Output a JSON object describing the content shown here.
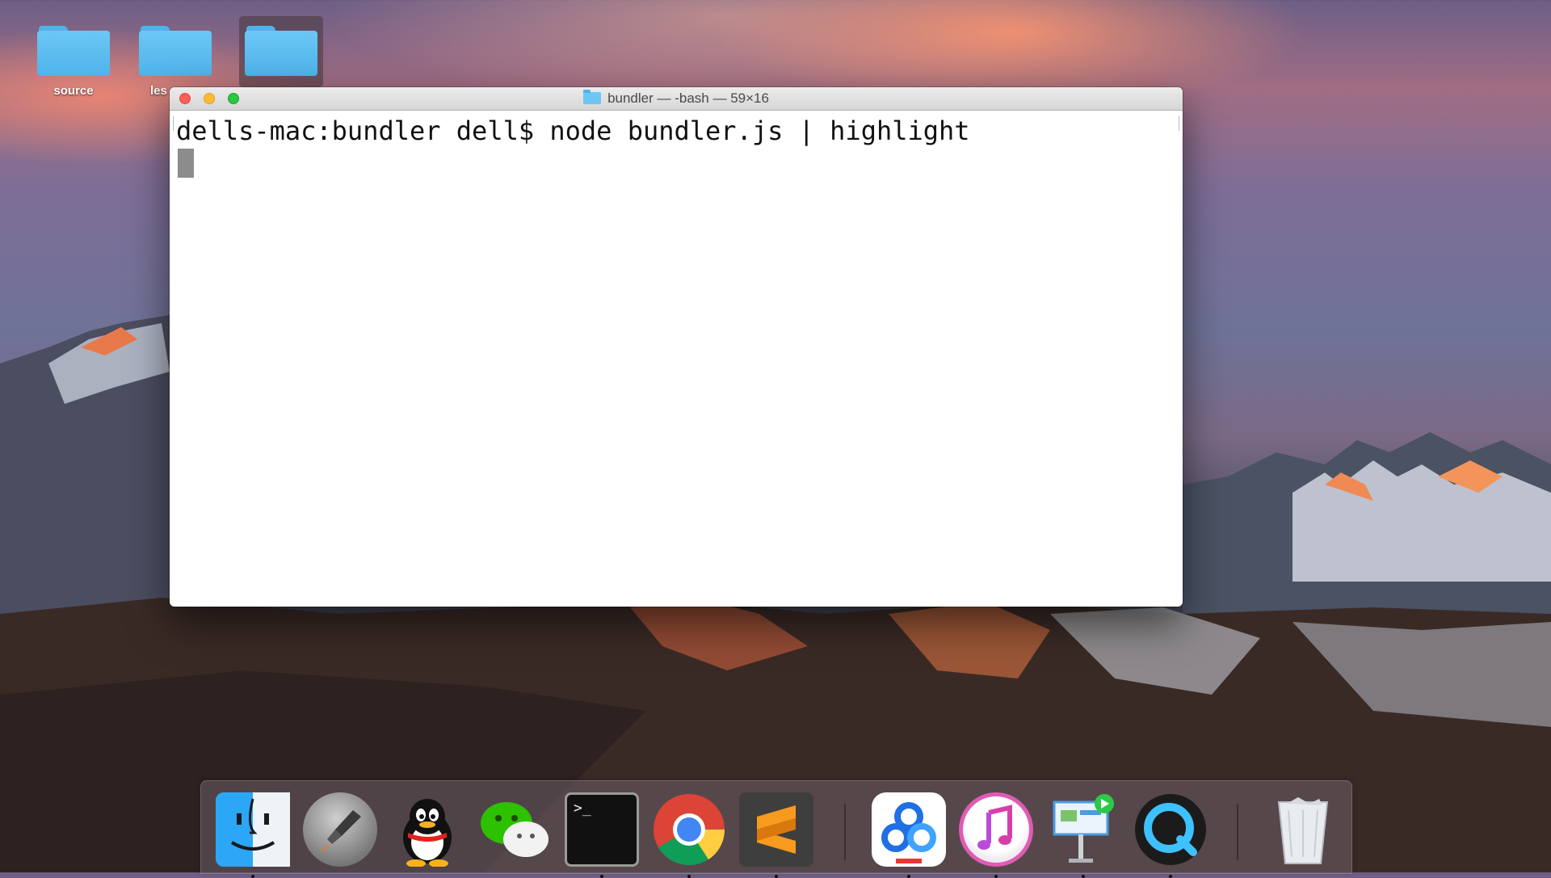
{
  "desktop": {
    "icons": [
      {
        "label": "source"
      },
      {
        "label": "les"
      },
      {
        "label": ""
      }
    ]
  },
  "terminal": {
    "title": "bundler — -bash — 59×16",
    "lines": [
      "dells-mac:bundler dell$ node bundler.js | highlight"
    ]
  },
  "dock": {
    "items": [
      {
        "icon": "finder-icon"
      },
      {
        "icon": "launchpad-icon"
      },
      {
        "icon": "qq-icon"
      },
      {
        "icon": "wechat-icon"
      },
      {
        "icon": "terminal-icon",
        "glyph": ">_"
      },
      {
        "icon": "chrome-icon"
      },
      {
        "icon": "sublime-text-icon"
      },
      {
        "icon": "baidu-netdisk-icon"
      },
      {
        "icon": "itunes-icon"
      },
      {
        "icon": "keynote-icon"
      },
      {
        "icon": "quicktime-icon"
      },
      {
        "icon": "trash-icon"
      }
    ]
  },
  "colors": {
    "folder": "#6cc7f5",
    "close": "#fc5f57",
    "minimize": "#fdbc2e",
    "zoom": "#28c840"
  }
}
